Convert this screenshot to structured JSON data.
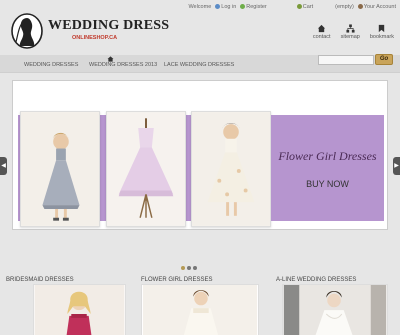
{
  "brand": {
    "name": "WEDDING DRESS",
    "tagline": "ONLINESHOP.CA",
    "accent_color": "#c0392b"
  },
  "top_links": {
    "welcome": "Welcome",
    "login": "Log in",
    "register": "Register",
    "cart": "Cart",
    "cart_status": "(empty)",
    "account": "Your Account"
  },
  "utility": {
    "contact": "contact",
    "sitemap": "sitemap",
    "bookmark": "bookmark"
  },
  "nav": {
    "items": [
      "WEDDING DRESSES",
      "WEDDING DRESSES 2013",
      "LACE WEDDING DRESSES"
    ],
    "home_icon": "home-icon"
  },
  "search": {
    "placeholder": "",
    "go_label": "Go"
  },
  "banner": {
    "heading": "Flower Girl Dresses",
    "cta": "BUY NOW",
    "band_color": "#b695cf"
  },
  "carousel": {
    "slide_count": 3,
    "active_index": 0
  },
  "categories": [
    {
      "title": "BRIDESMAID DRESSES"
    },
    {
      "title": "FLOWER GIRL DRESSES"
    },
    {
      "title": "A-LINE WEDDING DRESSES"
    }
  ]
}
